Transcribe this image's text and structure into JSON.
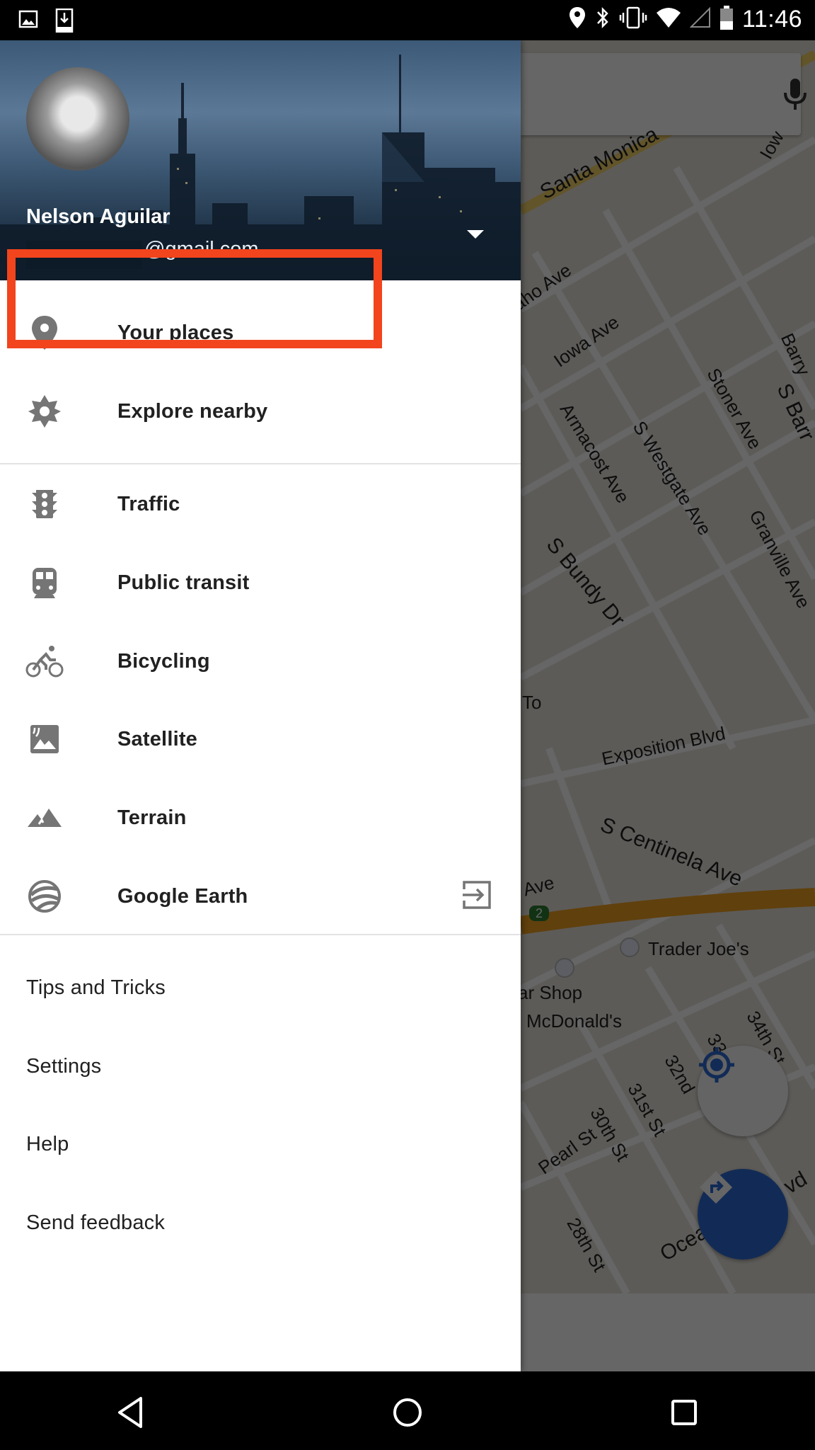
{
  "status_bar": {
    "left_icons": [
      "image-notification-icon",
      "download-notification-icon"
    ],
    "right_icons": [
      "location-icon",
      "bluetooth-icon",
      "vibrate-icon",
      "wifi-icon",
      "cell-signal-icon",
      "battery-icon"
    ],
    "time": "11:46"
  },
  "drawer": {
    "account": {
      "name": "Nelson Aguilar",
      "email_visible": "@gmail.com",
      "email_redacted": true
    },
    "highlighted_item": "Your places",
    "highlight_color": "#f2441d",
    "section1": [
      {
        "label": "Your places",
        "icon": "place-pin-icon"
      },
      {
        "label": "Explore nearby",
        "icon": "explore-nearby-icon"
      }
    ],
    "section2": [
      {
        "label": "Traffic",
        "icon": "traffic-light-icon"
      },
      {
        "label": "Public transit",
        "icon": "train-icon"
      },
      {
        "label": "Bicycling",
        "icon": "bicycle-icon"
      },
      {
        "label": "Satellite",
        "icon": "satellite-icon"
      },
      {
        "label": "Terrain",
        "icon": "terrain-icon"
      },
      {
        "label": "Google Earth",
        "icon": "google-earth-icon",
        "trailing_icon": "open-external-icon"
      }
    ],
    "section3": [
      {
        "label": "Tips and Tricks"
      },
      {
        "label": "Settings"
      },
      {
        "label": "Help"
      },
      {
        "label": "Send feedback"
      }
    ]
  },
  "map": {
    "labels": {
      "santa_monica": "Santa Monica",
      "iowa_ave_1": "Iowa Ave",
      "idaho_ave": "aho Ave",
      "iowa_ave_top": "Iow",
      "barry": "Barry",
      "armacost": "Armacost Ave",
      "westgate": "S Westgate Ave",
      "stoner": "Stoner Ave",
      "s_barr": "S Barr",
      "granville": "Granville Ave",
      "bundy": "S Bundy Dr",
      "to": "To",
      "exposition": "Exposition Blvd",
      "centinela": "S Centinela Ave",
      "ave": "Ave",
      "trader_joes": "Trader Joe's",
      "car_shop": "ar Shop",
      "mcdonalds": "McDonald's",
      "st34": "34th St",
      "st33": "33r",
      "st32": "32nd",
      "st31": "31st St",
      "st30": "30th St",
      "pearl": "Pearl St",
      "st28": "28th St",
      "ocean": "Ocea",
      "blvd": "vd"
    },
    "highway_shield": "2",
    "search_placeholder": "",
    "accent_color": "#2f6bd8"
  },
  "nav_bar": {
    "buttons": [
      "back-icon",
      "home-icon",
      "recents-icon"
    ]
  }
}
